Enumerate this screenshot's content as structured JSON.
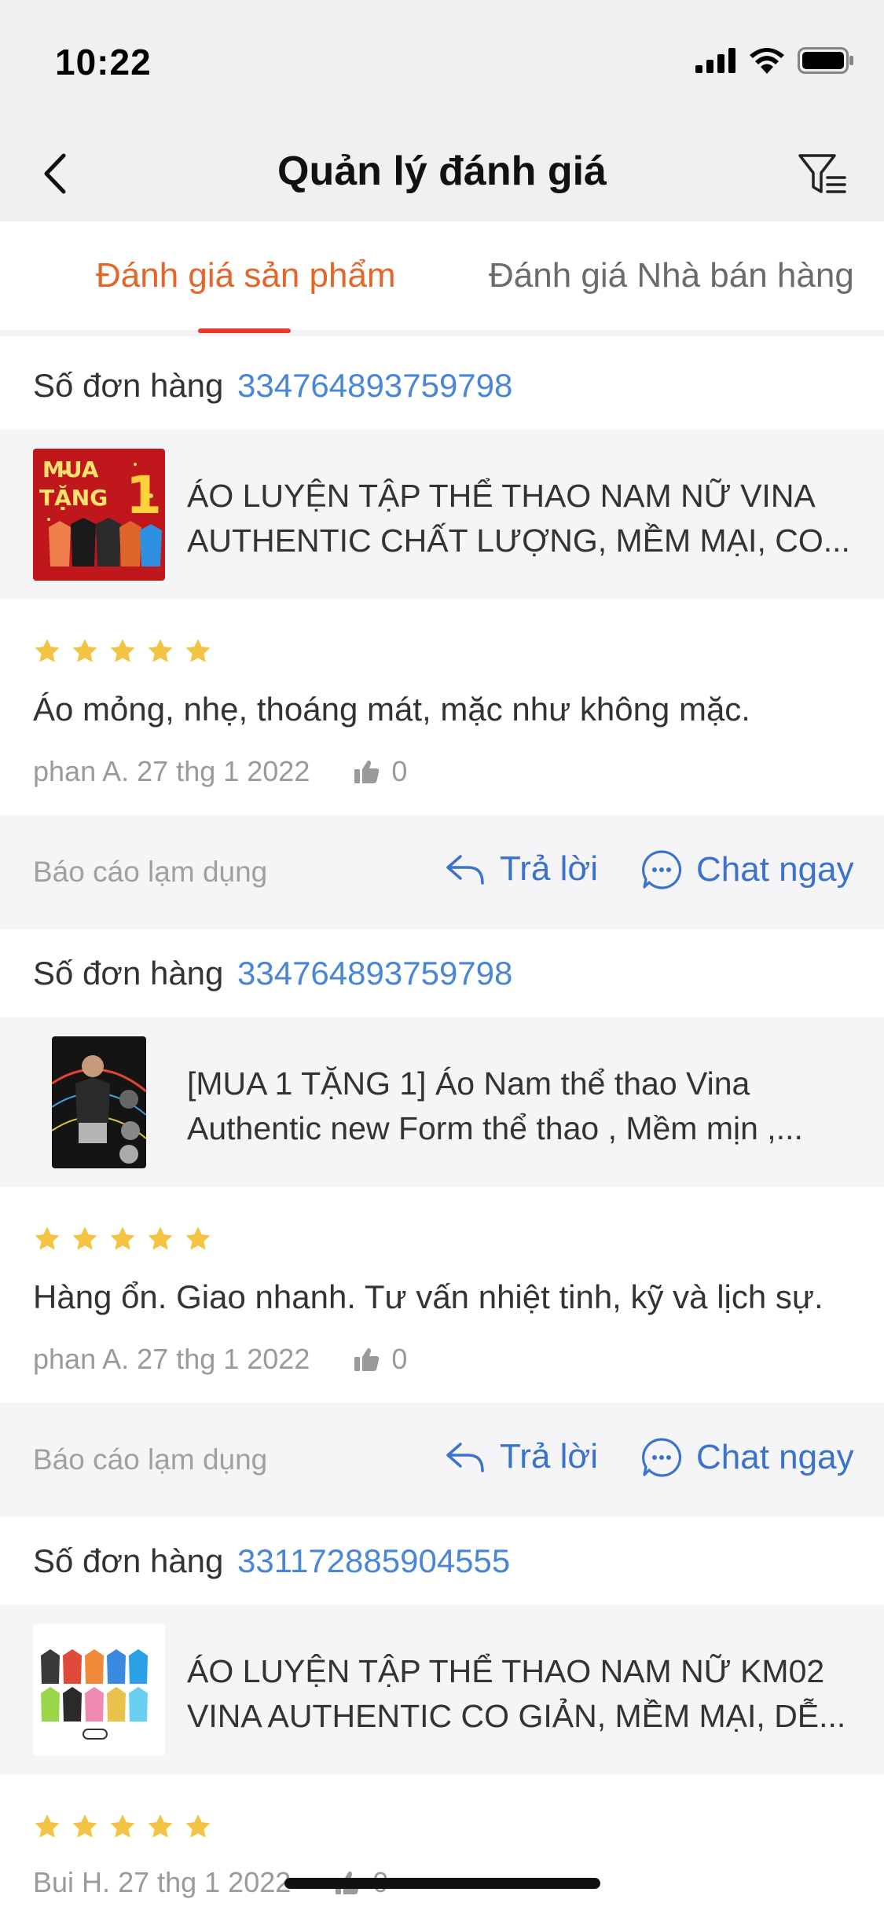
{
  "status_bar": {
    "time": "10:22"
  },
  "header": {
    "title": "Quản lý đánh giá"
  },
  "tabs": [
    {
      "label": "Đánh giá sản phẩm",
      "active": true
    },
    {
      "label": "Đánh giá Nhà bán hàng",
      "active": false
    }
  ],
  "common": {
    "order_label": "Số đơn hàng",
    "report_label": "Báo cáo lạm dụng",
    "reply_label": "Trả lời",
    "chat_label": "Chat ngay"
  },
  "reviews": [
    {
      "order_number": "334764893759798",
      "product_line1": "ÁO LUYỆN TẬP THỂ THAO NAM NỮ VINA",
      "product_line2": "AUTHENTIC CHẤT LƯỢNG, MỀM MẠI, CO...",
      "rating": 5,
      "text": "Áo mỏng, nhẹ, thoáng mát, mặc như không mặc.",
      "author": "phan A.",
      "date": "27 thg 1 2022",
      "likes": "0"
    },
    {
      "order_number": "334764893759798",
      "product_line1": "[MUA 1 TẶNG 1] Áo Nam thể thao Vina",
      "product_line2": "Authentic new Form thể thao , Mềm mịn ,...",
      "rating": 5,
      "text": "Hàng ổn. Giao nhanh. Tư vấn nhiệt tinh, kỹ và lịch sự.",
      "author": "phan A.",
      "date": "27 thg 1 2022",
      "likes": "0"
    },
    {
      "order_number": "331172885904555",
      "product_line1": "ÁO LUYỆN TẬP THỂ THAO NAM NỮ KM02",
      "product_line2": "VINA AUTHENTIC CO GIẢN, MỀM MẠI, DỄ...",
      "rating": 5,
      "text": "",
      "author": "Bui H.",
      "date": "27 thg 1 2022",
      "likes": "0"
    }
  ],
  "product_badge": {
    "line1": "MUA",
    "line2": "TẶNG",
    "digit": "1"
  },
  "colors": {
    "accent": "#e4662a",
    "link": "#4a86d6",
    "star": "#f5c342",
    "underline": "#e63b2e"
  }
}
